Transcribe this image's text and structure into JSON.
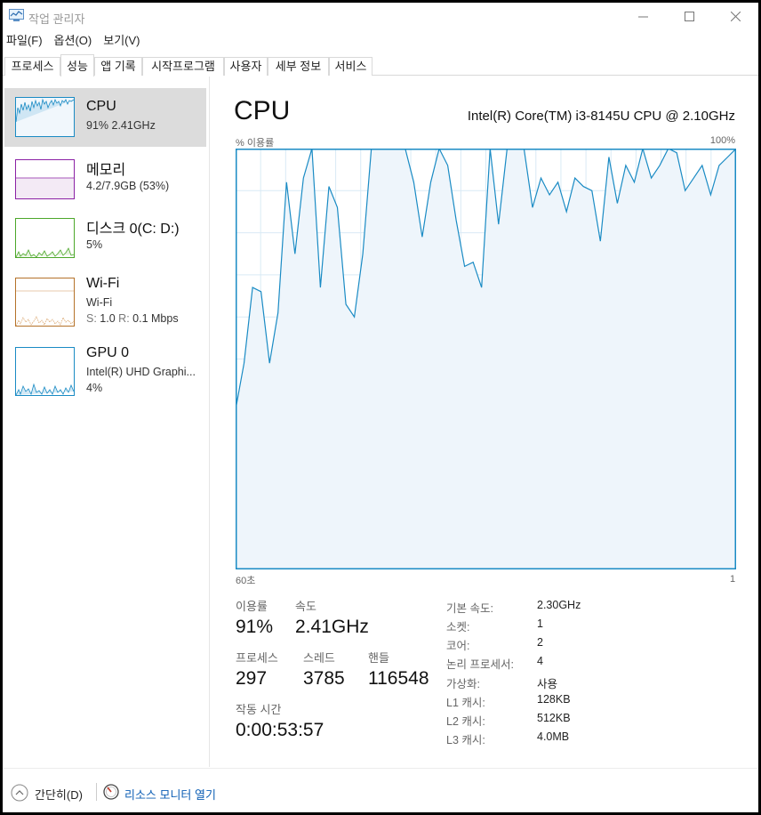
{
  "window": {
    "title": "작업 관리자"
  },
  "menu": [
    "파일(F)",
    "옵션(O)",
    "보기(V)"
  ],
  "tabs": [
    "프로세스",
    "성능",
    "앱 기록",
    "시작프로그램",
    "사용자",
    "세부 정보",
    "서비스"
  ],
  "active_tab": "성능",
  "sidebar": {
    "cpu": {
      "name": "CPU",
      "sub": "91% 2.41GHz",
      "color": "#1a8bc4"
    },
    "memory": {
      "name": "메모리",
      "sub": "4.2/7.9GB (53%)",
      "color": "#8b21a5"
    },
    "disk": {
      "name": "디스크 0(C: D:)",
      "sub": "5%",
      "color": "#4ca72a"
    },
    "wifi": {
      "name": "Wi-Fi",
      "sub1": "Wi-Fi",
      "send_label": "S:",
      "send_value": "1.0",
      "recv_label": "R:",
      "recv_value": "0.1 Mbps",
      "color": "#b5722a"
    },
    "gpu": {
      "name": "GPU 0",
      "sub1": "Intel(R) UHD Graphi...",
      "sub2": "4%",
      "color": "#1a8bc4"
    }
  },
  "main": {
    "title": "CPU",
    "model": "Intel(R) Core(TM) i3-8145U CPU @ 2.10GHz",
    "y_label": "% 이용률",
    "y_max_label": "100%",
    "x_left_label": "60초",
    "x_right_label": "1"
  },
  "chart_data": {
    "type": "area",
    "ylim": [
      0,
      100
    ],
    "grid": true,
    "color": "#1a8bc4",
    "x": [
      60,
      59,
      58,
      57,
      56,
      55,
      54,
      53,
      52,
      51,
      50,
      49,
      48,
      47,
      46,
      45,
      44,
      43,
      42,
      41,
      40,
      39,
      38,
      37,
      36,
      35,
      34,
      33,
      32,
      31,
      30,
      29,
      28,
      27,
      26,
      25,
      24,
      23,
      22,
      21,
      20,
      19,
      18,
      17,
      16,
      15,
      14,
      13,
      12,
      11,
      10,
      9,
      8,
      7,
      6,
      5,
      4,
      3,
      2,
      1
    ],
    "y": [
      38,
      49,
      67,
      66,
      49,
      61,
      92,
      75,
      93,
      100,
      67,
      91,
      86,
      63,
      60,
      75,
      100,
      100,
      100,
      100,
      100,
      92,
      79,
      92,
      100,
      96,
      83,
      72,
      73,
      67,
      100,
      82,
      100,
      100,
      100,
      86,
      93,
      89,
      92,
      85,
      93,
      91,
      90,
      78,
      98,
      87,
      96,
      92,
      100,
      93,
      96,
      100,
      99,
      90,
      93,
      96,
      89,
      96,
      98,
      100
    ]
  },
  "stats": {
    "utilization_label": "이용률",
    "utilization_value": "91%",
    "speed_label": "속도",
    "speed_value": "2.41GHz",
    "processes_label": "프로세스",
    "processes_value": "297",
    "threads_label": "스레드",
    "threads_value": "3785",
    "handles_label": "핸들",
    "handles_value": "116548",
    "uptime_label": "작동 시간",
    "uptime_value": "0:00:53:57"
  },
  "specs": [
    {
      "label": "기본 속도:",
      "value": "2.30GHz"
    },
    {
      "label": "소켓:",
      "value": "1"
    },
    {
      "label": "코어:",
      "value": "2"
    },
    {
      "label": "논리 프로세서:",
      "value": "4"
    },
    {
      "label": "가상화:",
      "value": "사용"
    },
    {
      "label": "L1 캐시:",
      "value": "128KB"
    },
    {
      "label": "L2 캐시:",
      "value": "512KB"
    },
    {
      "label": "L3 캐시:",
      "value": "4.0MB"
    }
  ],
  "footer": {
    "fewer_details": "간단히(D)",
    "resource_monitor": "리소스 모니터 열기"
  }
}
